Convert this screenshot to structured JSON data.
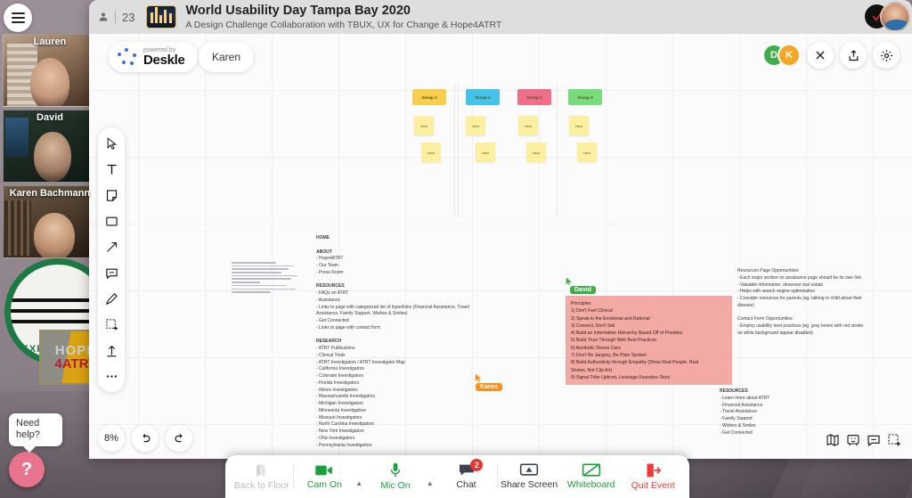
{
  "app": {
    "participant_count": "23",
    "title": "World Usability Day Tampa Bay 2020",
    "subtitle": "A Design Challenge Collaboration with TBUX, UX for Change & Hope4ATRT",
    "brand": {
      "powered_by": "powered by",
      "name": "Deskle"
    },
    "current_user_pill": "Karen",
    "zoom_level": "8%",
    "accent_green": "#1aa03c",
    "accent_red": "#ec3a36",
    "note_pink": "#f3a9a4"
  },
  "avatars": [
    {
      "initial": "D",
      "color": "#3fae4a"
    },
    {
      "initial": "K",
      "color": "#f5a623"
    }
  ],
  "video_tiles": [
    {
      "name": "Lauren"
    },
    {
      "name": "David"
    },
    {
      "name": "Karen Bachmann"
    }
  ],
  "help": {
    "tooltip": "Need help?",
    "icon": "question-mark"
  },
  "toolbar": {
    "items": [
      {
        "icon": "cursor-icon",
        "label": "Select"
      },
      {
        "icon": "text-icon",
        "label": "Text"
      },
      {
        "icon": "sticky-note-icon",
        "label": "Sticky note"
      },
      {
        "icon": "rectangle-icon",
        "label": "Shape"
      },
      {
        "icon": "arrow-icon",
        "label": "Arrow"
      },
      {
        "icon": "comment-icon",
        "label": "Comment"
      },
      {
        "icon": "pencil-icon",
        "label": "Draw"
      },
      {
        "icon": "frame-select-icon",
        "label": "Frame"
      },
      {
        "icon": "upload-icon",
        "label": "Upload"
      },
      {
        "icon": "more-icon",
        "label": "More"
      }
    ]
  },
  "canvas_controls": {
    "undo": "undo-icon",
    "redo": "redo-icon",
    "bottom_right": [
      {
        "icon": "map-icon"
      },
      {
        "icon": "presentation-icon"
      },
      {
        "icon": "comment-icon"
      },
      {
        "icon": "frame-add-icon"
      }
    ]
  },
  "header_actions": [
    {
      "icon": "close-icon"
    },
    {
      "icon": "share-icon"
    },
    {
      "icon": "gear-icon"
    }
  ],
  "groups": [
    {
      "label": "Group 1",
      "color": "#f7ce4e",
      "ideas": [
        "Idea",
        "Idea"
      ]
    },
    {
      "label": "Group 2",
      "color": "#43c2ea",
      "ideas": [
        "Idea",
        "Idea"
      ]
    },
    {
      "label": "Group 3",
      "color": "#ef6f8a",
      "ideas": [
        "Idea",
        "Idea"
      ]
    },
    {
      "label": "Group 4",
      "color": "#79dc7c",
      "ideas": [
        "Idea",
        "Idea"
      ]
    }
  ],
  "sitemap": {
    "lines": [
      "HOME",
      "",
      "ABOUT",
      "- Hope4ATRT",
      "- Our Team",
      "- Press Room",
      "",
      "RESOURCES",
      "- FAQs on ATRT",
      "- Assistance",
      "   - Links to page with categorized list of hyperlinks (Financial Assistance, Travel",
      "Assistance, Family Support, Wishes & Smiles)",
      "- Get Connected",
      "   - Links to page with contact form",
      "",
      "RESEARCH",
      "-  ATRT Publications",
      "- Clinical Trials",
      "- ATRT Investigators / ATRT Investigator Map",
      "    - California Investigators",
      "    - Colorado Investigators",
      "    - Florida Investigators",
      "    - Illinois Investigators",
      "    - Massachusetts Investigators",
      "    - Michigan Investigators",
      "    - Minnesota Investigators",
      "    - Missouri Investigators",
      "    - North Carolina Investigators",
      "    - New York Investigators",
      "    - Ohio Investigators",
      "    - Pennsylvania Investigators"
    ]
  },
  "pink_note": {
    "author": "David",
    "author_color": "#3fae4a",
    "lines": [
      "Principles:",
      "1) Don't Feel Clinical",
      "2) Speak to the Emotional and Rational",
      "3) Connect, Don't Sell",
      "4) Build an Information Hierarchy Based Off of Priorities",
      "5) Build Trust Through Web Best Practices",
      "6) Aesthetic Shows Care",
      "7) Don't Be Jargony, Be Plain Spoken",
      "8) Build Authenticity through Empathy (Show Real People, Real",
      "Stories, Not Clip Art)",
      "9) Signal Tribe Upfront, Leverage Founders Story"
    ]
  },
  "right_notes": {
    "lines": [
      "Resources Page Opportunities:",
      "- Each major section on assistance page should be its own link",
      "     - Valuable information, deserves real estate",
      "     - Helps with search engine optimization",
      "- Consider resources for parents (eg. talking to child about their",
      "disease)",
      "",
      "Contact Form Opportunities:",
      "- Employ usability best practices (eg. gray boxes with red stroke",
      "on white background appear disabled)"
    ]
  },
  "resources_list": {
    "lines": [
      "RESOURCES",
      "- Learn more about ATRT",
      "- Financial Assistance",
      "- Travel Assistance",
      "- Family Support",
      "- Wishes & Smiles",
      "- Get Connected"
    ]
  },
  "cursors": [
    {
      "name": "David",
      "color": "#3fae4a"
    },
    {
      "name": "Karen",
      "color": "#f5921e"
    }
  ],
  "event_bar": {
    "buttons": [
      {
        "label": "Back to Floor",
        "icon": "floor-map-icon",
        "state": "disabled"
      },
      {
        "label": "Cam On",
        "icon": "camera-icon",
        "state": "on"
      },
      {
        "label": "Mic On",
        "icon": "microphone-icon",
        "state": "on"
      },
      {
        "label": "Chat",
        "icon": "chat-icon",
        "state": "default",
        "badge": "2"
      },
      {
        "label": "Share Screen",
        "icon": "screen-share-icon",
        "state": "default"
      },
      {
        "label": "Whiteboard",
        "icon": "whiteboard-icon",
        "state": "on"
      },
      {
        "label": "Quit Event",
        "icon": "exit-icon",
        "state": "danger"
      }
    ]
  }
}
